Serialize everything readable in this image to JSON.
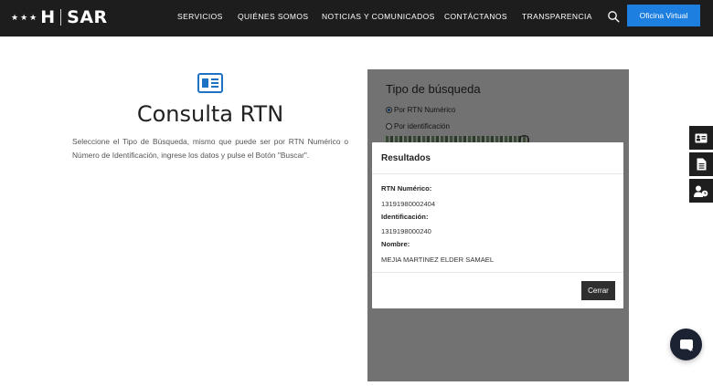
{
  "header": {
    "logo": {
      "stars": "★★★",
      "letter": "H",
      "brand": "SAR"
    },
    "nav": [
      {
        "label": "SERVICIOS"
      },
      {
        "label": "QUIÉNES SOMOS"
      },
      {
        "label": "NOTICIAS Y COMUNICADOS"
      },
      {
        "label": "CONTÁCTANOS"
      },
      {
        "label": "TRANSPARENCIA"
      }
    ],
    "search_icon": "search-icon",
    "oficina_virtual_label": "Oficina Virtual",
    "accent_color": "#1d7fe0"
  },
  "main": {
    "icon": "id-card-icon",
    "title": "Consulta RTN",
    "description": "Seleccione el Tipo de Búsqueda, mismo que puede ser por RTN Numérico o Número de Identificación, ingrese los datos y pulse el Botón \"Buscar\"."
  },
  "form": {
    "title": "Tipo de búsqueda",
    "options": [
      {
        "label": "Por RTN Numérico",
        "selected": true
      },
      {
        "label": "Por identificación",
        "selected": false
      }
    ]
  },
  "modal": {
    "title": "Resultados",
    "fields": [
      {
        "label": "RTN Numérico:",
        "value": "13191980002404"
      },
      {
        "label": "Identificación:",
        "value": "1319198000240"
      },
      {
        "label": "Nombre:",
        "value": "MEJIA MARTINEZ ELDER SAMAEL"
      }
    ],
    "close_label": "Cerrar"
  },
  "side_tabs": [
    {
      "icon": "id-card-icon"
    },
    {
      "icon": "document-icon"
    },
    {
      "icon": "user-clock-icon"
    }
  ],
  "chat": {
    "icon": "chat-bubble-icon"
  }
}
